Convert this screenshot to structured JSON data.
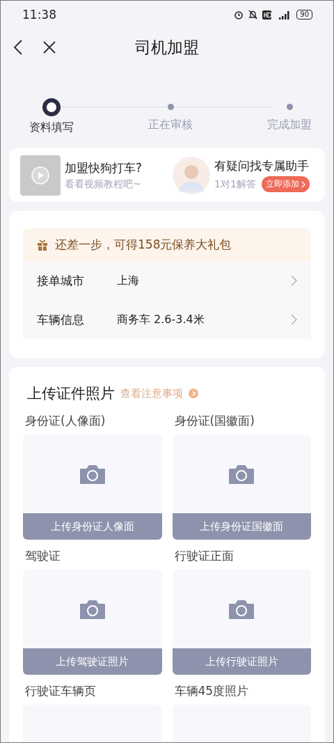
{
  "status_bar": {
    "time": "11:38",
    "battery": "90"
  },
  "nav": {
    "title": "司机加盟"
  },
  "steps": [
    {
      "label": "资料填写",
      "selected": true
    },
    {
      "label": "正在审核",
      "selected": false
    },
    {
      "label": "完成加盟",
      "selected": false
    }
  ],
  "promos": [
    {
      "kind": "video",
      "title": "加盟快狗打车?",
      "subtitle": "看看视频教程吧~"
    },
    {
      "kind": "assistant",
      "title": "有疑问找专属助手",
      "subtitle": "1对1解答",
      "button": "立即添加"
    }
  ],
  "bonus": {
    "text": "还差一步，可得158元保养大礼包"
  },
  "info_rows": [
    {
      "label": "接单城市",
      "value": "上海"
    },
    {
      "label": "车辆信息",
      "value": "商务车 2.6-3.4米"
    }
  ],
  "uploads": {
    "title": "上传证件照片",
    "link": "查看注意事项",
    "items": [
      {
        "label": "身份证(人像面)",
        "button": "上传身份证人像面"
      },
      {
        "label": "身份证(国徽面)",
        "button": "上传身份证国徽面"
      },
      {
        "label": "驾驶证",
        "button": "上传驾驶证照片"
      },
      {
        "label": "行驶证正面",
        "button": "上传行驶证照片"
      },
      {
        "label": "行驶证车辆页"
      },
      {
        "label": "车辆45度照片"
      }
    ]
  }
}
